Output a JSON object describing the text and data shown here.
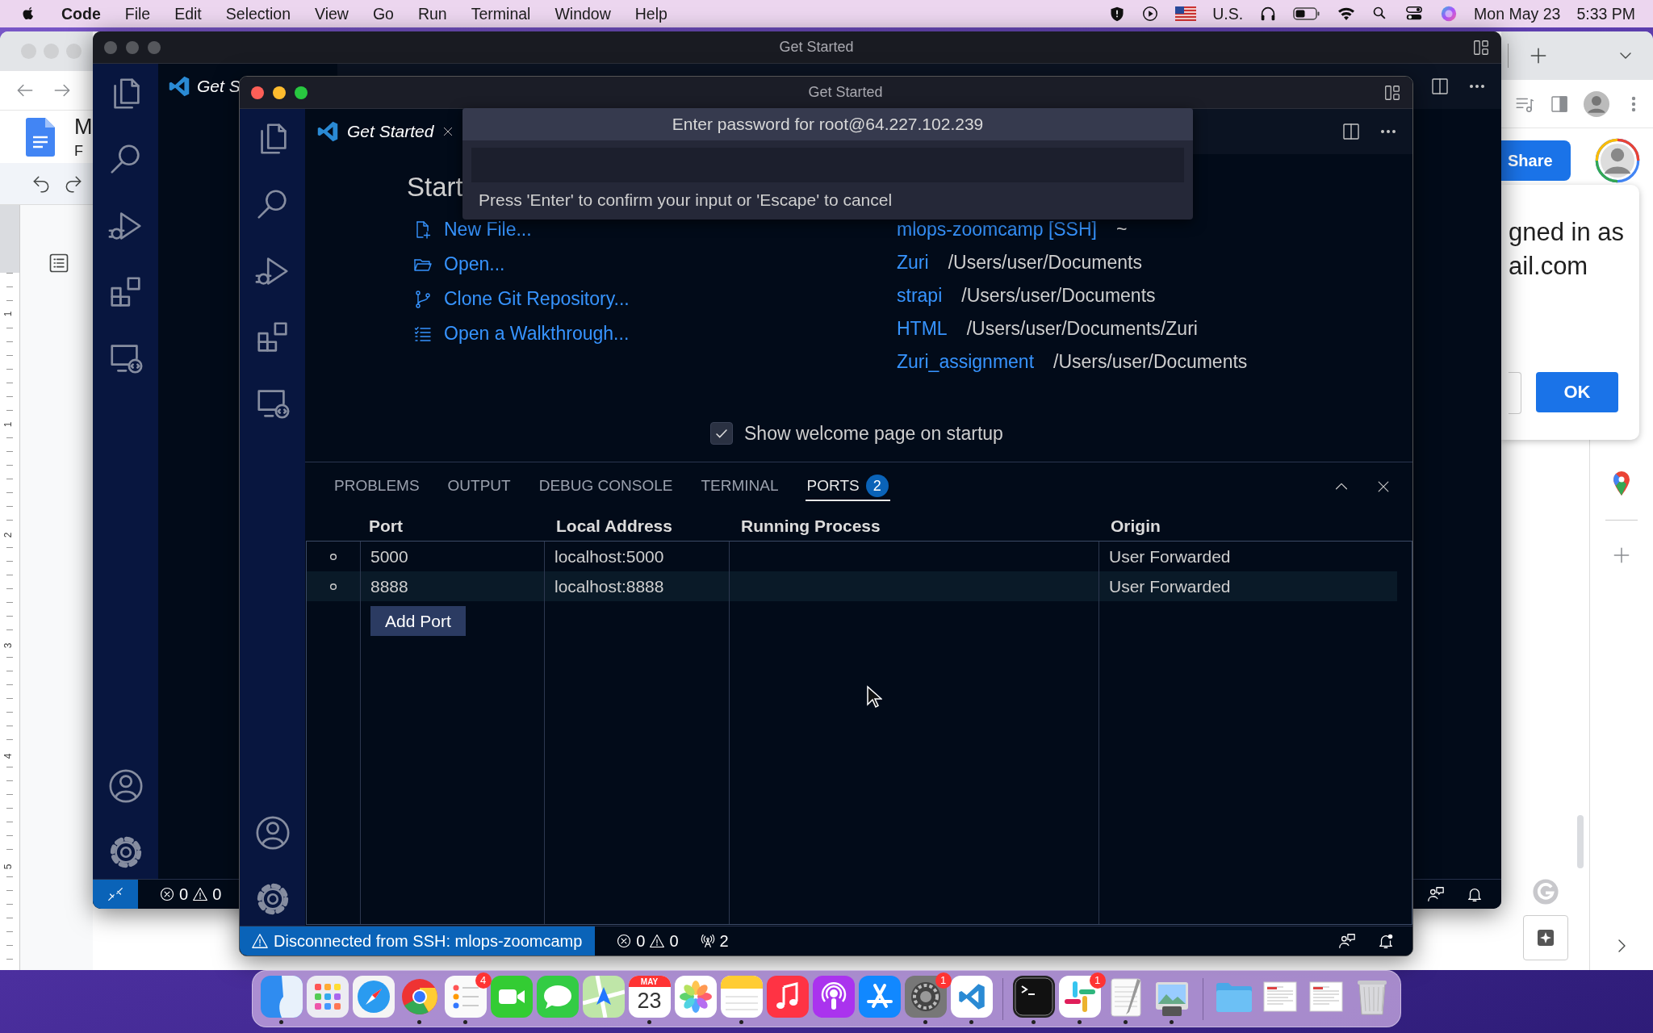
{
  "menu_bar": {
    "app": "Code",
    "menus": [
      "File",
      "Edit",
      "Selection",
      "View",
      "Go",
      "Run",
      "Terminal",
      "Window",
      "Help"
    ],
    "input_source": "U.S.",
    "date": "Mon May 23",
    "time": "5:33 PM"
  },
  "browser_window": {
    "doc_title": "M",
    "doc_subtitle": "F",
    "share_button": "Share",
    "dialog": {
      "lines": [
        "gned in as",
        "ail.com"
      ],
      "ok_button": "OK"
    },
    "ruler_labels": [
      "1",
      "1",
      "2",
      "3",
      "4",
      "5"
    ]
  },
  "back_window": {
    "title": "Get Started",
    "tab": "Get S",
    "status_bar": {
      "errors": "0",
      "warnings": "0"
    }
  },
  "front_window": {
    "title": "Get Started",
    "tab": "Get Started",
    "heading": "Start",
    "start_items": [
      {
        "kind": "new-file",
        "label": "New File..."
      },
      {
        "kind": "open",
        "label": "Open..."
      },
      {
        "kind": "clone",
        "label": "Clone Git Repository..."
      },
      {
        "kind": "walkthrough",
        "label": "Open a Walkthrough..."
      }
    ],
    "recent": [
      {
        "name": "mlops-zoomcamp [SSH]",
        "path": "~"
      },
      {
        "name": "Zuri",
        "path": "/Users/user/Documents"
      },
      {
        "name": "strapi",
        "path": "/Users/user/Documents"
      },
      {
        "name": "HTML",
        "path": "/Users/user/Documents/Zuri"
      },
      {
        "name": "Zuri_assignment",
        "path": "/Users/user/Documents"
      }
    ],
    "welcome_checkbox": {
      "label": "Show welcome page on startup",
      "checked": true
    },
    "panel": {
      "tabs": [
        {
          "label": "PROBLEMS",
          "selected": false
        },
        {
          "label": "OUTPUT",
          "selected": false
        },
        {
          "label": "DEBUG CONSOLE",
          "selected": false
        },
        {
          "label": "TERMINAL",
          "selected": false
        },
        {
          "label": "PORTS",
          "selected": true,
          "badge": "2"
        }
      ],
      "columns": [
        "Port",
        "Local Address",
        "Running Process",
        "Origin"
      ],
      "rows": [
        {
          "port": "5000",
          "local_address": "localhost:5000",
          "origin": "User Forwarded",
          "selected": false
        },
        {
          "port": "8888",
          "local_address": "localhost:8888",
          "origin": "User Forwarded",
          "selected": true
        }
      ],
      "add_button": "Add Port"
    },
    "status_bar": {
      "remote": "Disconnected from SSH: mlops-zoomcamp",
      "errors": "0",
      "warnings": "0",
      "ports": "2"
    }
  },
  "quick_input": {
    "title": "Enter password for root@64.227.102.239",
    "message": "Press 'Enter' to confirm your input or 'Escape' to cancel"
  },
  "dock": {
    "groups": [
      [
        {
          "kind": "finder",
          "running": true
        },
        {
          "kind": "launchpad",
          "running": false
        },
        {
          "kind": "safari",
          "running": false
        },
        {
          "kind": "chrome",
          "running": true
        },
        {
          "kind": "reminders",
          "running": true,
          "badge": "4"
        },
        {
          "kind": "facetime",
          "running": false
        },
        {
          "kind": "messages",
          "running": false
        },
        {
          "kind": "maps",
          "running": false
        },
        {
          "kind": "calendar",
          "running": true,
          "month": "MAY",
          "day": "23"
        },
        {
          "kind": "photos",
          "running": false
        },
        {
          "kind": "notes",
          "running": true
        },
        {
          "kind": "music",
          "running": false
        },
        {
          "kind": "podcasts",
          "running": false
        },
        {
          "kind": "appstore",
          "running": false
        },
        {
          "kind": "settings",
          "running": true,
          "badge": "1"
        },
        {
          "kind": "vscode",
          "running": true
        }
      ],
      [
        {
          "kind": "terminal",
          "running": true
        },
        {
          "kind": "slack",
          "running": true,
          "badge": "1"
        },
        {
          "kind": "textedit",
          "running": true
        },
        {
          "kind": "preview",
          "running": true
        }
      ],
      [
        {
          "kind": "folder",
          "running": false
        },
        {
          "kind": "document",
          "running": false
        },
        {
          "kind": "document",
          "running": false
        },
        {
          "kind": "trash",
          "running": false
        }
      ]
    ]
  }
}
